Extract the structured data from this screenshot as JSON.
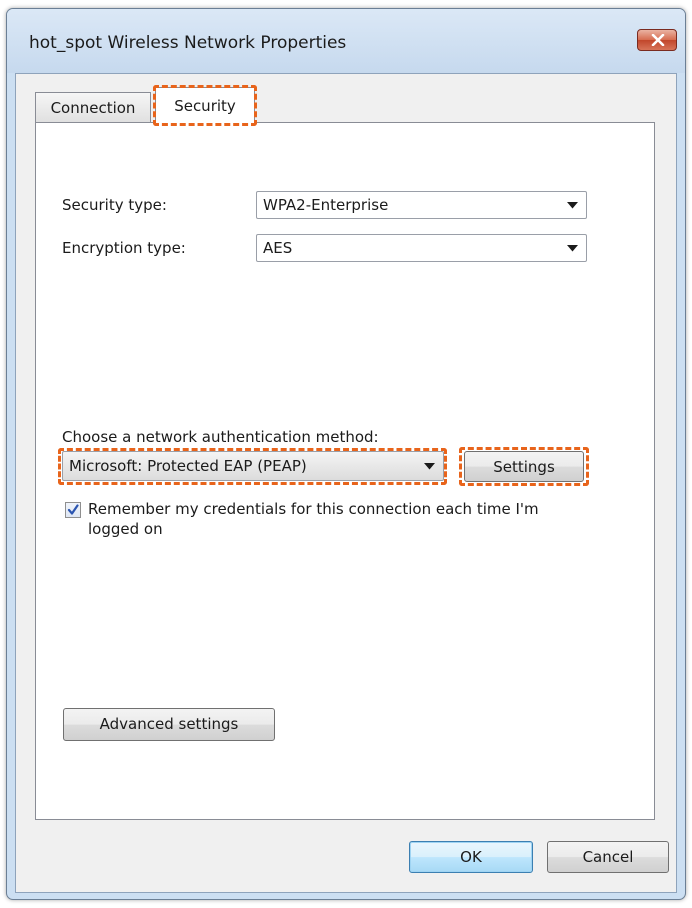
{
  "window": {
    "title": "hot_spot Wireless Network Properties",
    "close_icon": "close-icon"
  },
  "tabs": [
    {
      "label": "Connection",
      "selected": false
    },
    {
      "label": "Security",
      "selected": true
    }
  ],
  "security": {
    "security_type_label": "Security type:",
    "security_type_value": "WPA2-Enterprise",
    "encryption_type_label": "Encryption type:",
    "encryption_type_value": "AES",
    "auth_method_label": "Choose a network authentication method:",
    "auth_method_value": "Microsoft: Protected EAP (PEAP)",
    "settings_button": "Settings",
    "remember_credentials_label": "Remember my credentials for this connection each time I'm logged on",
    "remember_credentials_checked": true,
    "advanced_settings_button": "Advanced settings"
  },
  "footer": {
    "ok_button": "OK",
    "cancel_button": "Cancel"
  },
  "colors": {
    "highlight": "#e8641b",
    "close_button": "#c1462b",
    "title_bar": "#ccdff2"
  }
}
